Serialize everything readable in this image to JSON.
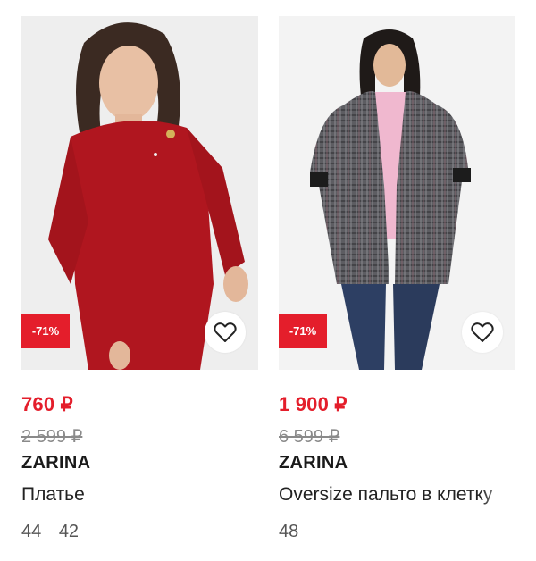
{
  "products": [
    {
      "discount": "-71%",
      "price": "760 ₽",
      "old_price": "2 599 ₽",
      "brand": "ZARINA",
      "name": "Платье",
      "sizes": [
        "44",
        "42"
      ],
      "colors": {
        "accent": "#e41e2b",
        "garment": "#b0161f"
      }
    },
    {
      "discount": "-71%",
      "price": "1 900 ₽",
      "old_price": "6 599 ₽",
      "brand": "ZARINA",
      "name": "Oversize пальто в клетку",
      "sizes": [
        "48"
      ],
      "colors": {
        "accent": "#e41e2b",
        "garment": "#5f5f63"
      }
    }
  ],
  "icons": {
    "favorite": "heart-outline-icon"
  }
}
